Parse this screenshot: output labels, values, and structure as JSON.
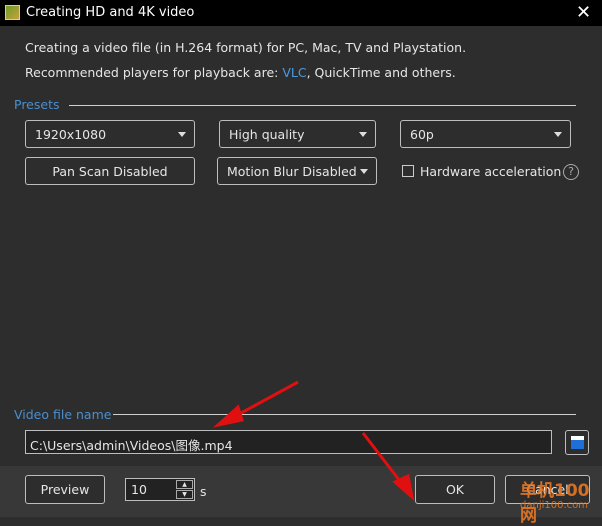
{
  "window": {
    "title": "Creating HD and 4K video"
  },
  "intro": {
    "line1": "Creating a video file (in H.264 format) for PC, Mac, TV and Playstation.",
    "line2_prefix": "Recommended players for playback are: ",
    "line2_link": "VLC",
    "line2_suffix": ", QuickTime and others."
  },
  "presets": {
    "label": "Presets",
    "resolution": "1920x1080",
    "quality": "High quality",
    "framerate": "60p",
    "pan_scan": "Pan  Scan Disabled",
    "motion_blur": "Motion Blur Disabled",
    "hardware_accel": {
      "label": "Hardware acceleration",
      "checked": false
    },
    "help": "?"
  },
  "file": {
    "label": "Video file name",
    "path": "C:\\Users\\admin\\Videos\\图像.mp4"
  },
  "footer": {
    "preview": "Preview",
    "duration": "10",
    "unit": "s",
    "ok": "OK",
    "cancel": "Cancel"
  },
  "watermark": {
    "text": "单机100网",
    "url": "danji100.com"
  },
  "colors": {
    "accent": "#4a8fcf",
    "annotation_arrow": "#e01010"
  }
}
